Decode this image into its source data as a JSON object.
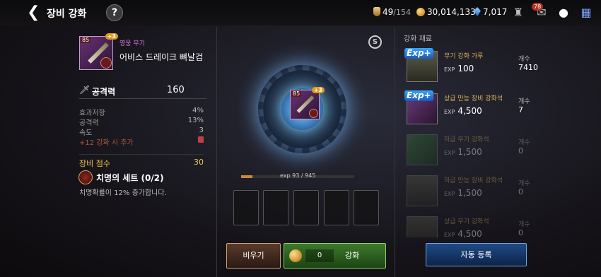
{
  "header": {
    "back_icon": "back-arrow-icon",
    "title": "장비 강화",
    "help_label": "?",
    "stamina": "49",
    "stamina_max": "/154",
    "gold": "30,014,133",
    "gems": "7,017",
    "notification_count": "78"
  },
  "weapon": {
    "level": "85",
    "plus": "+3",
    "grade": "영웅 무기",
    "name": "어비스 드레이크 뼈날검",
    "attack_label": "공격력",
    "attack_value": "160",
    "stats": [
      {
        "label": "효과저항",
        "value": "4%"
      },
      {
        "label": "공격력",
        "value": "13%"
      },
      {
        "label": "속도",
        "value": "3"
      }
    ],
    "bonus_text": "+12 강화 시 추가",
    "score_label": "장비 점수",
    "score_value": "30",
    "set_title": "치명의 세트 (0/2)",
    "set_desc": "치명확률이 12% 증가합니다."
  },
  "center": {
    "s_label": "S",
    "exp_text": "exp 93 / 945",
    "exp_fraction": 0.098,
    "empty_button": "비우기",
    "enhance_cost": "0",
    "enhance_button": "강화"
  },
  "materials": {
    "title": "강화 재료",
    "exp_tag": "Exp+",
    "count_label": "개수",
    "items": [
      {
        "name": "무기 강화 가루",
        "exp": "100",
        "count": "7410"
      },
      {
        "name": "상급 만능 장비 강화석",
        "exp": "4,500",
        "count": "7"
      },
      {
        "name": "하급 무기 강화석",
        "exp": "1,500",
        "count": "0"
      },
      {
        "name": "하급 만능 장비 강화석",
        "exp": "1,500",
        "count": "0"
      },
      {
        "name": "상급 무기 강화석",
        "exp": "4,500",
        "count": "0"
      }
    ],
    "auto_button": "자동 등록"
  }
}
